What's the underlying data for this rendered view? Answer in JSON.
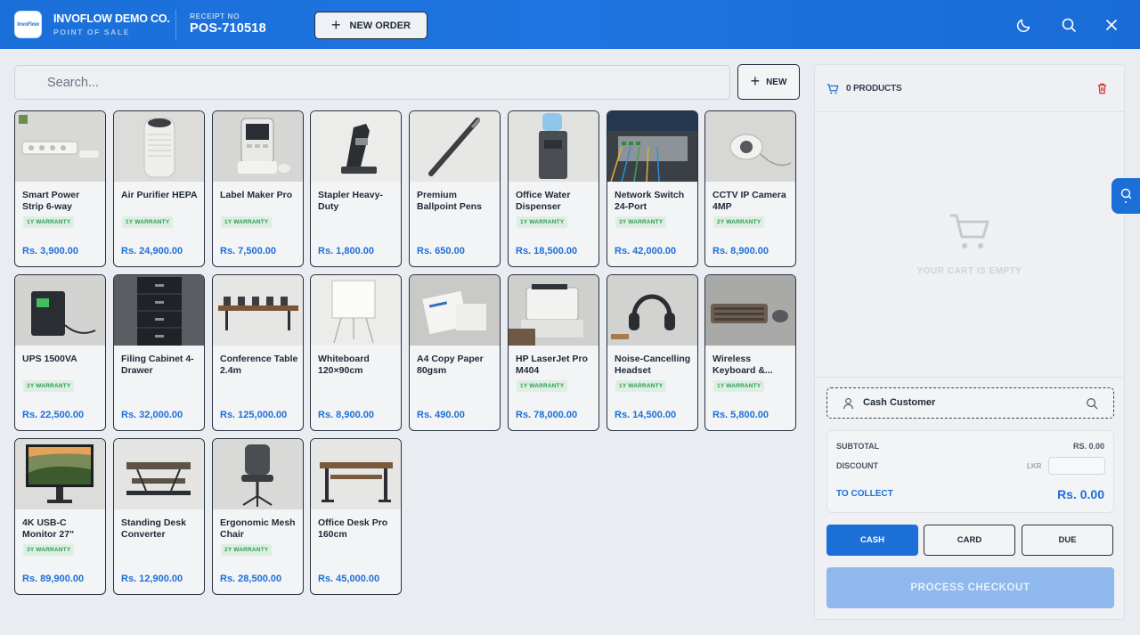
{
  "header": {
    "logo_text": "InvoFlow",
    "company": "INVOFLOW DEMO CO.",
    "subtitle": "POINT OF SALE",
    "receipt_label": "RECEIPT NO",
    "receipt_no": "POS-710518",
    "new_order_label": "NEW ORDER",
    "icons": [
      "moon-icon",
      "search-icon",
      "close-icon"
    ]
  },
  "search": {
    "placeholder": "Search...",
    "new_label": "NEW"
  },
  "products": [
    {
      "name": "Smart Power Strip 6-way",
      "warranty": "1Y WARRANTY",
      "price": "Rs. 3,900.00",
      "image": "power-strip"
    },
    {
      "name": "Air Purifier HEPA",
      "warranty": "1Y WARRANTY",
      "price": "Rs. 24,900.00",
      "image": "air-purifier"
    },
    {
      "name": "Label Maker Pro",
      "warranty": "1Y WARRANTY",
      "price": "Rs. 7,500.00",
      "image": "label-maker"
    },
    {
      "name": "Stapler Heavy-Duty",
      "warranty": "",
      "price": "Rs. 1,800.00",
      "image": "stapler"
    },
    {
      "name": "Premium Ballpoint Pens",
      "warranty": "",
      "price": "Rs. 650.00",
      "image": "pen"
    },
    {
      "name": "Office Water Dispenser",
      "warranty": "1Y WARRANTY",
      "price": "Rs. 18,500.00",
      "image": "water-dispenser"
    },
    {
      "name": "Network Switch 24-Port",
      "warranty": "3Y WARRANTY",
      "price": "Rs. 42,000.00",
      "image": "network-switch"
    },
    {
      "name": "CCTV IP Camera 4MP",
      "warranty": "2Y WARRANTY",
      "price": "Rs. 8,900.00",
      "image": "cctv-camera"
    },
    {
      "name": "UPS 1500VA",
      "warranty": "2Y WARRANTY",
      "price": "Rs. 22,500.00",
      "image": "ups"
    },
    {
      "name": "Filing Cabinet 4-Drawer",
      "warranty": "",
      "price": "Rs. 32,000.00",
      "image": "filing-cabinet"
    },
    {
      "name": "Conference Table 2.4m",
      "warranty": "",
      "price": "Rs. 125,000.00",
      "image": "conference-table"
    },
    {
      "name": "Whiteboard 120×90cm",
      "warranty": "",
      "price": "Rs. 8,900.00",
      "image": "whiteboard"
    },
    {
      "name": "A4 Copy Paper 80gsm",
      "warranty": "",
      "price": "Rs. 490.00",
      "image": "copy-paper"
    },
    {
      "name": "HP LaserJet Pro M404",
      "warranty": "1Y WARRANTY",
      "price": "Rs. 78,000.00",
      "image": "printer"
    },
    {
      "name": "Noise-Cancelling Headset",
      "warranty": "1Y WARRANTY",
      "price": "Rs. 14,500.00",
      "image": "headset"
    },
    {
      "name": "Wireless Keyboard &...",
      "warranty": "1Y WARRANTY",
      "price": "Rs. 5,800.00",
      "image": "keyboard"
    },
    {
      "name": "4K USB-C Monitor 27\"",
      "warranty": "3Y WARRANTY",
      "price": "Rs. 89,900.00",
      "image": "monitor"
    },
    {
      "name": "Standing Desk Converter",
      "warranty": "",
      "price": "Rs. 12,900.00",
      "image": "desk-converter"
    },
    {
      "name": "Ergonomic Mesh Chair",
      "warranty": "2Y WARRANTY",
      "price": "Rs. 28,500.00",
      "image": "mesh-chair"
    },
    {
      "name": "Office Desk Pro 160cm",
      "warranty": "",
      "price": "Rs. 45,000.00",
      "image": "office-desk"
    }
  ],
  "cart": {
    "count_label": "0 PRODUCTS",
    "empty_text": "YOUR CART IS EMPTY",
    "customer": "Cash Customer",
    "subtotal_label": "SUBTOTAL",
    "subtotal_value": "RS. 0.00",
    "discount_label": "DISCOUNT",
    "discount_currency": "LKR",
    "discount_value": "",
    "collect_label": "TO COLLECT",
    "collect_value": "Rs. 0.00",
    "payment_methods": [
      "CASH",
      "CARD",
      "DUE"
    ],
    "selected_payment": "CASH",
    "checkout_label": "PROCESS CHECKOUT"
  },
  "colors": {
    "accent": "#1d6fd8",
    "header": "#1e74e0",
    "warranty_bg": "#dcefe2",
    "warranty_text": "#2f9a55",
    "danger": "#dc3b3b"
  }
}
